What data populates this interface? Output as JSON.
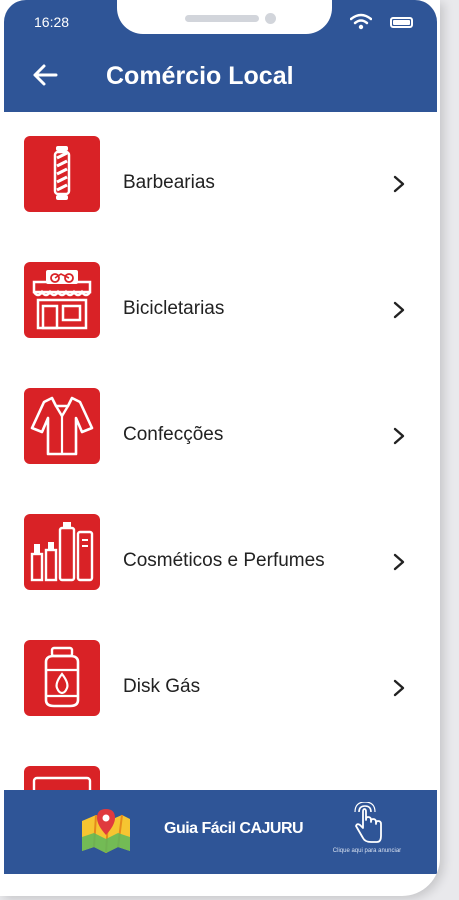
{
  "status_bar": {
    "time": "16:28"
  },
  "header": {
    "title": "Comércio Local"
  },
  "categories": [
    {
      "label": "Barbearias",
      "icon": "barber-pole-icon"
    },
    {
      "label": "Bicicletarias",
      "icon": "bicycle-shop-icon"
    },
    {
      "label": "Confecções",
      "icon": "shirt-icon"
    },
    {
      "label": "Cosméticos e Perfumes",
      "icon": "cosmetics-icon"
    },
    {
      "label": "Disk Gás",
      "icon": "gas-cylinder-icon"
    }
  ],
  "footer": {
    "brand": "Guia Fácil CAJURU",
    "cta": "Clique aqui para anunciar"
  },
  "colors": {
    "header": "#2f5597",
    "tile": "#d92226",
    "text": "#222222"
  }
}
